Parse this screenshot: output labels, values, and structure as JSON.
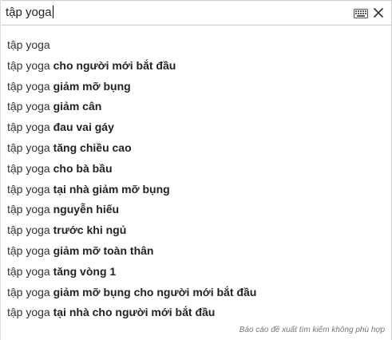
{
  "search": {
    "value": "tập yoga"
  },
  "icons": {
    "keyboard": "keyboard-icon",
    "close": "close-icon"
  },
  "suggestions": [
    {
      "prefix": "tập yoga",
      "suffix": ""
    },
    {
      "prefix": "tập yoga ",
      "suffix": "cho người mới bắt đầu"
    },
    {
      "prefix": "tập yoga ",
      "suffix": "giảm mỡ bụng"
    },
    {
      "prefix": "tập yoga ",
      "suffix": "giảm cân"
    },
    {
      "prefix": "tập yoga ",
      "suffix": "đau vai gáy"
    },
    {
      "prefix": "tập yoga ",
      "suffix": "tăng chiều cao"
    },
    {
      "prefix": "tập yoga ",
      "suffix": "cho bà bầu"
    },
    {
      "prefix": "tập yoga ",
      "suffix": "tại nhà giảm mỡ bụng"
    },
    {
      "prefix": "tập yoga ",
      "suffix": "nguyễn hiếu"
    },
    {
      "prefix": "tập yoga ",
      "suffix": "trước khi ngủ"
    },
    {
      "prefix": "tập yoga ",
      "suffix": "giảm mỡ toàn thân"
    },
    {
      "prefix": "tập yoga ",
      "suffix": "tăng vòng 1"
    },
    {
      "prefix": "tập yoga ",
      "suffix": "giảm mỡ bụng cho người mới bắt đầu"
    },
    {
      "prefix": "tập yoga ",
      "suffix": "tại nhà cho người mới bắt đầu"
    }
  ],
  "footer": {
    "report_label": "Báo cáo đề xuất tìm kiếm không phù hợp"
  },
  "colors": {
    "text": "#333333",
    "bold_text": "#222222",
    "muted": "#767676",
    "border": "#cfcfcf"
  }
}
